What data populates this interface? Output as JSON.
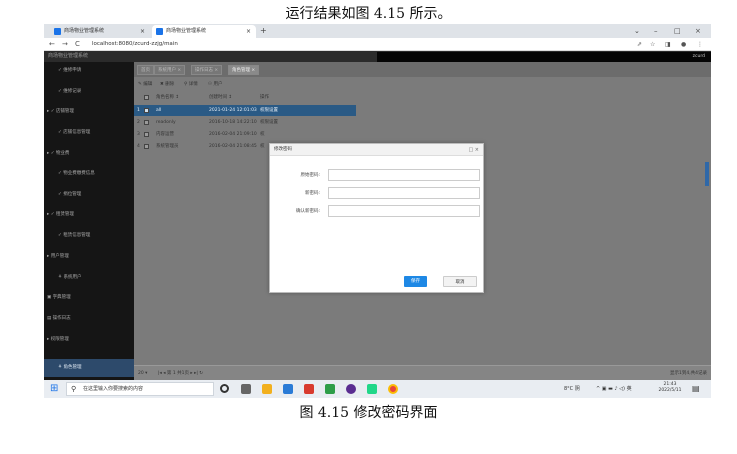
{
  "captions": {
    "top": "运行结果如图 4.15 所示。",
    "bottom": "图 4.15 修改密码界面"
  },
  "browser": {
    "tabs": [
      {
        "label": "商场物业管理系统",
        "close": "×"
      },
      {
        "label": "商场物业管理系统",
        "close": "×"
      }
    ],
    "new_tab": "+",
    "window_controls": {
      "chevron": "⌄",
      "minimize": "–",
      "maximize": "□",
      "close": "×"
    },
    "nav": {
      "back": "←",
      "forward": "→",
      "reload": "C"
    },
    "url": "localhost:8080/zcurd-zzjg/main",
    "address_icons": {
      "share": "⇗",
      "star": "☆",
      "sidepanel": "◨",
      "profile": "●",
      "menu": "⋮"
    }
  },
  "app": {
    "title": "商场物业管理系统",
    "username": "zcurd"
  },
  "sidebar": {
    "items": [
      {
        "label": "✓ 维修申请",
        "kind": "sub"
      },
      {
        "label": "✓ 维修记录",
        "kind": "sub"
      },
      {
        "label": "▸ ✓ 店铺管理",
        "kind": "top"
      },
      {
        "label": "✓ 店铺信息管理",
        "kind": "sub"
      },
      {
        "label": "▸ ✓ 物业费",
        "kind": "top"
      },
      {
        "label": "✓ 物业费缴费信息",
        "kind": "sub"
      },
      {
        "label": "✓ 捐位管理",
        "kind": "sub"
      },
      {
        "label": "▸ ✓ 租赁管理",
        "kind": "top"
      },
      {
        "label": "✓ 租赁信息管理",
        "kind": "sub"
      },
      {
        "label": "▸ 用户管理",
        "kind": "top"
      },
      {
        "label": "⚘ 系统用户",
        "kind": "sub"
      },
      {
        "label": "▣ 字典管理",
        "kind": "top"
      },
      {
        "label": "▤ 操作日志",
        "kind": "top"
      },
      {
        "label": "▸ 权限管理",
        "kind": "top"
      },
      {
        "label": "⚘ 角色管理",
        "kind": "sub",
        "active": true
      }
    ]
  },
  "content": {
    "tabs": [
      {
        "label": "首页"
      },
      {
        "label": "系统用户 ×"
      },
      {
        "label": "操作日志 ×"
      },
      {
        "label": "角色管理 ×",
        "active": true
      }
    ],
    "toolbar": [
      {
        "label": "✎ 编辑"
      },
      {
        "label": "✖ 删除"
      },
      {
        "label": "⚲ 详情"
      },
      {
        "label": "⚇ 用户"
      }
    ],
    "grid": {
      "headers": [
        "角色名称 ↕",
        "创建时间 ↕",
        "操作"
      ],
      "rows": [
        {
          "num": "1",
          "name": "all",
          "time": "2021-01-24 12:01:03",
          "op": "权限设置",
          "selected": true
        },
        {
          "num": "2",
          "name": "readonly",
          "time": "2016-10-18 14:22:10",
          "op": "权限设置"
        },
        {
          "num": "3",
          "name": "内容运营",
          "time": "2016-02-04 21:09:10",
          "op": "权"
        },
        {
          "num": "4",
          "name": "系统管理员",
          "time": "2016-02-04 21:08:45",
          "op": "权"
        }
      ]
    },
    "pager": {
      "page_size": "20 ▾",
      "controls": "|◂  ◂  第 1    共1页  ▸  ▸|  ↻",
      "summary": "显示1到4,共4记录"
    }
  },
  "dialog": {
    "title": "修改密码",
    "controls": "□ ×",
    "fields": [
      {
        "label": "原始密码:",
        "value": ""
      },
      {
        "label": "新密码:",
        "value": ""
      },
      {
        "label": "确认新密码:",
        "value": ""
      }
    ],
    "save": "保存",
    "cancel": "取消"
  },
  "taskbar": {
    "start_icon": "windows-logo",
    "search_placeholder": "在这里输入你要搜索的内容",
    "weather": "8°C 阴",
    "tray": "^ ▣ ▬ ♪ ◁) 英",
    "time": "21:43",
    "date": "2022/5/11",
    "apps": [
      {
        "name": "cortana",
        "color": "#333333"
      },
      {
        "name": "task-view",
        "color": "#555555"
      },
      {
        "name": "file-explorer",
        "color": "#f2b01e"
      },
      {
        "name": "store",
        "color": "#2a7bd6"
      },
      {
        "name": "wps",
        "color": "#d83b2e"
      },
      {
        "name": "green-app",
        "color": "#2e9e48"
      },
      {
        "name": "purple-app",
        "color": "#5a2d91"
      },
      {
        "name": "pycharm",
        "color": "#21d789"
      },
      {
        "name": "chrome",
        "color": "#e8453c"
      }
    ]
  },
  "colors": {
    "sidebar_bg": "#151515",
    "content_bg": "#7b7b7b",
    "selected_row": "#2a5a85",
    "save_button": "#1e88e5",
    "active_menu": "#2d4a6b"
  }
}
